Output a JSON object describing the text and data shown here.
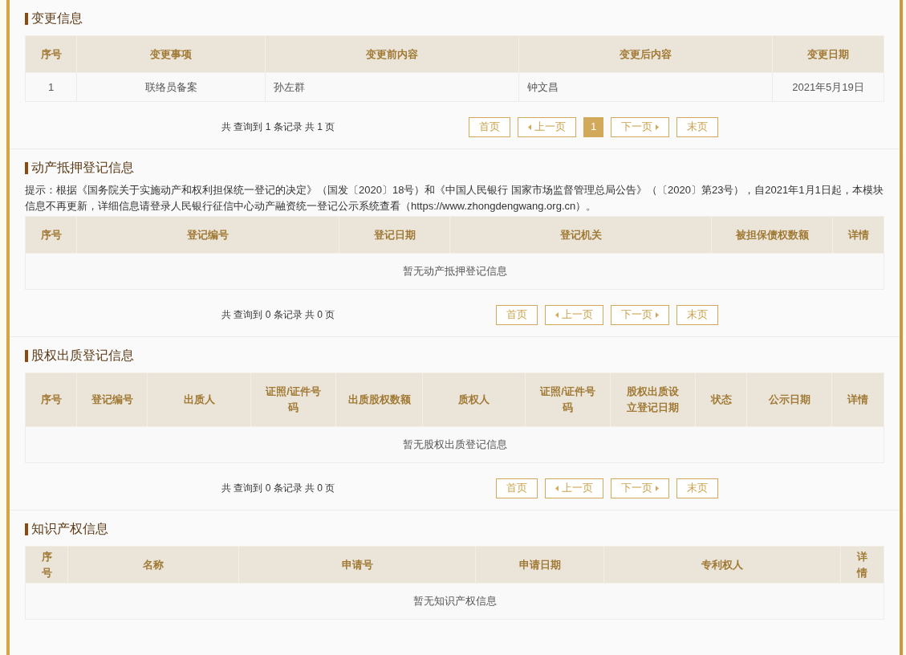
{
  "sections": [
    {
      "title": "变更信息",
      "columns": [
        "序号",
        "变更事项",
        "变更前内容",
        "变更后内容",
        "变更日期"
      ],
      "rows": [
        [
          "1",
          "联络员备案",
          "孙左群",
          "钟文昌",
          "2021年5月19日"
        ]
      ],
      "pagination": {
        "summary": "共 查询到 1 条记录 共 1 页",
        "buttons": [
          {
            "label": "首页",
            "kind": "first",
            "selected": false
          },
          {
            "label": "上一页",
            "kind": "prev",
            "selected": false
          },
          {
            "label": "1",
            "kind": "page",
            "selected": true
          },
          {
            "label": "下一页",
            "kind": "next",
            "selected": false
          },
          {
            "label": "末页",
            "kind": "last",
            "selected": false
          }
        ]
      }
    },
    {
      "title": "动产抵押登记信息",
      "notice": "提示：根据《国务院关于实施动产和权利担保统一登记的决定》（国发〔2020〕18号）和《中国人民银行 国家市场监督管理总局公告》（〔2020〕第23号），自2021年1月1日起，本模块信息不再更新，详细信息请登录人民银行征信中心动产融资统一登记公示系统查看（https://www.zhongdengwang.org.cn）。",
      "columns": [
        "序号",
        "登记编号",
        "登记日期",
        "登记机关",
        "被担保债权数额",
        "详情"
      ],
      "empty": "暂无动产抵押登记信息",
      "pagination": {
        "summary": "共 查询到 0 条记录 共 0 页",
        "buttons": [
          {
            "label": "首页",
            "kind": "first",
            "selected": false
          },
          {
            "label": "上一页",
            "kind": "prev",
            "selected": false
          },
          {
            "label": "下一页",
            "kind": "next",
            "selected": false
          },
          {
            "label": "末页",
            "kind": "last",
            "selected": false
          }
        ]
      }
    },
    {
      "title": "股权出质登记信息",
      "columns": [
        "序号",
        "登记编号",
        "出质人",
        "证照/证件号码",
        "出质股权数额",
        "质权人",
        "证照/证件号码",
        "股权出质设立登记日期",
        "状态",
        "公示日期",
        "详情"
      ],
      "empty": "暂无股权出质登记信息",
      "pagination": {
        "summary": "共 查询到 0 条记录 共 0 页",
        "buttons": [
          {
            "label": "首页",
            "kind": "first",
            "selected": false
          },
          {
            "label": "上一页",
            "kind": "prev",
            "selected": false
          },
          {
            "label": "下一页",
            "kind": "next",
            "selected": false
          },
          {
            "label": "末页",
            "kind": "last",
            "selected": false
          }
        ]
      }
    },
    {
      "title": "知识产权信息",
      "columns": [
        "序号",
        "名称",
        "申请号",
        "申请日期",
        "专利权人",
        "详情"
      ],
      "empty": "暂无知识产权信息"
    }
  ]
}
